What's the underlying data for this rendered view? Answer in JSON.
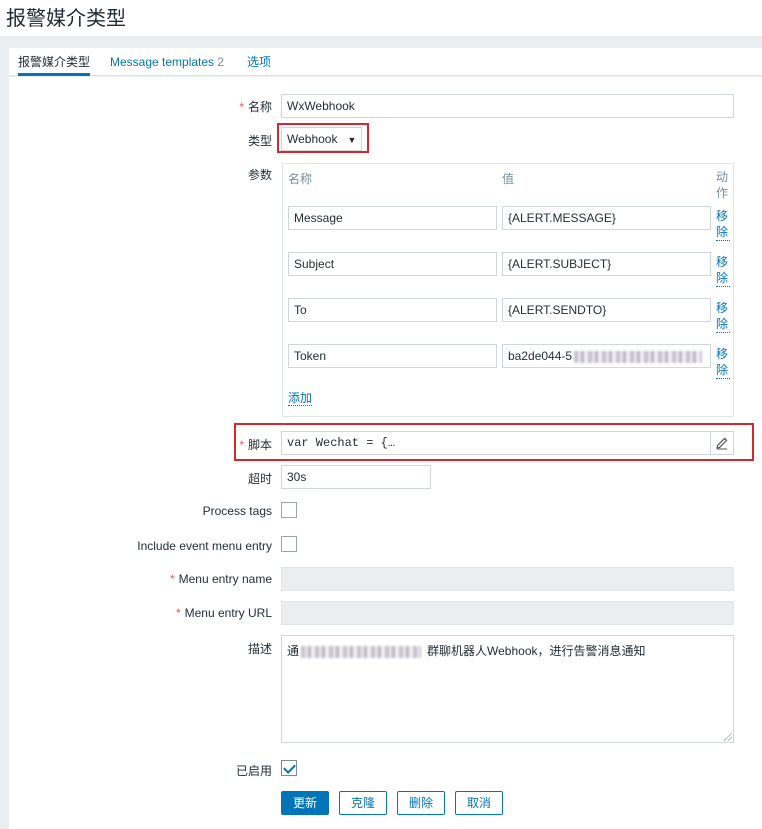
{
  "page": {
    "title": "报警媒介类型"
  },
  "tabs": [
    {
      "label": "报警媒介类型"
    },
    {
      "label": "Message templates",
      "count": "2"
    },
    {
      "label": "选项"
    }
  ],
  "form": {
    "name": {
      "label": "名称",
      "required": "*",
      "value": "WxWebhook"
    },
    "type": {
      "label": "类型",
      "value": "Webhook"
    },
    "params": {
      "label": "参数",
      "headers": {
        "name": "名称",
        "value": "值",
        "action": "动作"
      },
      "rows": [
        {
          "name": "Message",
          "value": "{ALERT.MESSAGE}",
          "action": "移除"
        },
        {
          "name": "Subject",
          "value": "{ALERT.SUBJECT}",
          "action": "移除"
        },
        {
          "name": "To",
          "value": "{ALERT.SENDTO}",
          "action": "移除"
        },
        {
          "name": "Token",
          "value": "ba2de044-5",
          "action": "移除"
        }
      ],
      "add_label": "添加"
    },
    "script": {
      "label": "脚本",
      "required": "*",
      "value": "var Wechat = {…"
    },
    "timeout": {
      "label": "超时",
      "value": "30s"
    },
    "process_tags": {
      "label": "Process tags"
    },
    "include_event_menu": {
      "label": "Include event menu entry"
    },
    "menu_entry_name": {
      "label": "Menu entry name",
      "required": "*"
    },
    "menu_entry_url": {
      "label": "Menu entry URL",
      "required": "*"
    },
    "description": {
      "label": "描述",
      "value_start": "通",
      "value_end": "群聊机器人Webhook，进行告警消息通知"
    },
    "enabled": {
      "label": "已启用"
    }
  },
  "buttons": {
    "update": "更新",
    "clone": "克隆",
    "delete": "删除",
    "cancel": "取消"
  },
  "colors": {
    "accent": "#0275b8",
    "highlight": "#d5272f",
    "required": "#e45959"
  }
}
